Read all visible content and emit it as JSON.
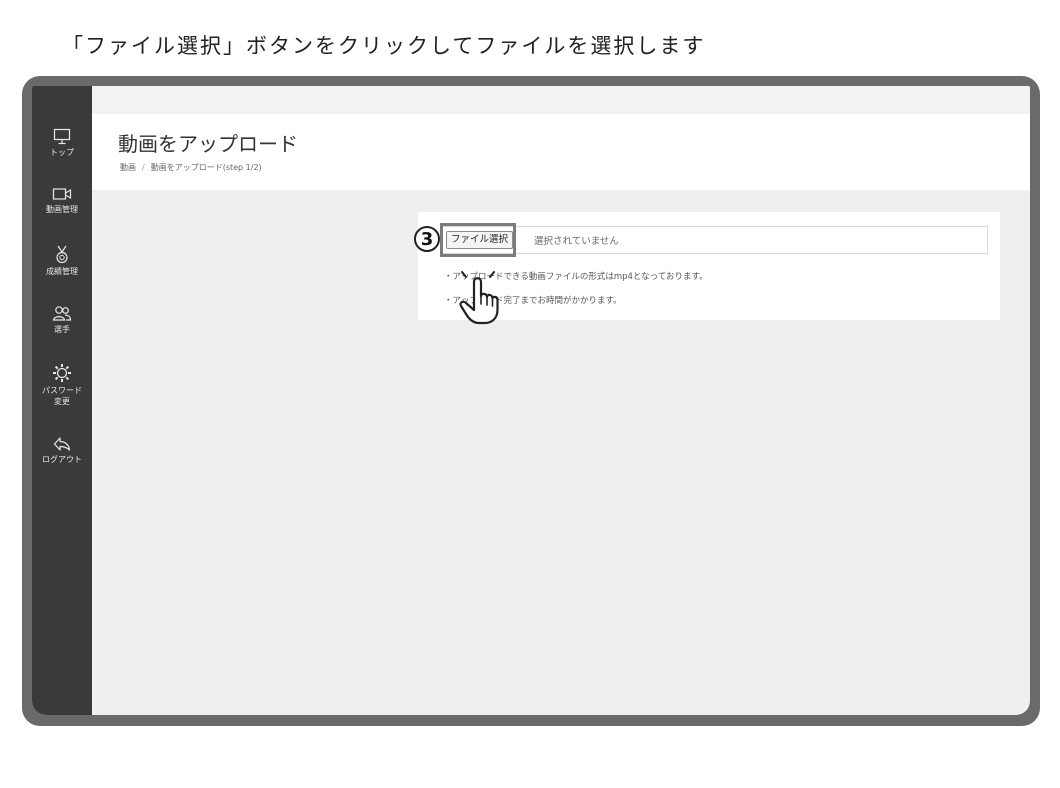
{
  "instruction": "「ファイル選択」ボタンをクリックしてファイルを選択します",
  "sidebar": {
    "items": [
      {
        "icon": "monitor-icon",
        "label": "トップ"
      },
      {
        "icon": "video-camera-icon",
        "label": "動画管理"
      },
      {
        "icon": "medal-icon",
        "label": "成績管理"
      },
      {
        "icon": "users-icon",
        "label": "選手"
      },
      {
        "icon": "gear-icon",
        "label": "パスワード\n変更"
      },
      {
        "icon": "logout-icon",
        "label": "ログアウト"
      }
    ]
  },
  "header": {
    "title": "動画をアップロード",
    "breadcrumb": [
      "動画",
      "動画をアップロード(step 1/2)"
    ]
  },
  "upload": {
    "button_label": "ファイル選択",
    "status": "選択されていません",
    "notes": [
      "・アップロードできる動画ファイルの形式はmp4となっております。",
      "・アップロード完了までお時間がかかります。"
    ]
  },
  "annotation": {
    "step": "3"
  },
  "colors": {
    "sidebar_bg": "#3a3a3a",
    "frame": "#6a6a6a",
    "content_bg": "#efefef",
    "highlight": "#7b7b7b"
  }
}
